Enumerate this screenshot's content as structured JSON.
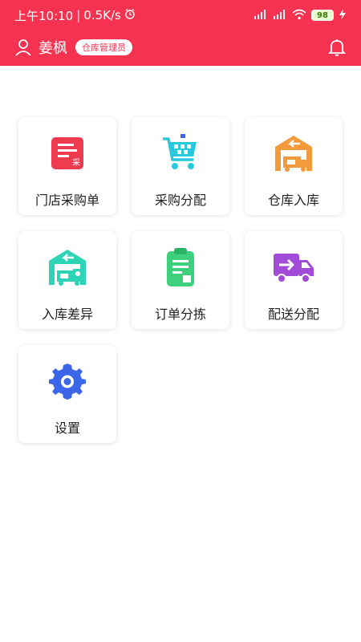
{
  "status": {
    "time": "上午10:10",
    "speed": "0.5K/s",
    "battery": "98"
  },
  "header": {
    "user_name": "姜枫",
    "role": "仓库管理员"
  },
  "menu": [
    {
      "label": "门店采购单",
      "icon": "store-purchase-order-icon",
      "badge": "采"
    },
    {
      "label": "采购分配",
      "icon": "shopping-cart-icon"
    },
    {
      "label": "仓库入库",
      "icon": "warehouse-inbound-icon"
    },
    {
      "label": "入库差异",
      "icon": "inbound-difference-icon"
    },
    {
      "label": "订单分拣",
      "icon": "clipboard-icon"
    },
    {
      "label": "配送分配",
      "icon": "delivery-truck-icon"
    },
    {
      "label": "设置",
      "icon": "gear-icon"
    }
  ],
  "colors": {
    "header": "#f5324f",
    "red_icon": "#ef3b4f",
    "cyan": "#28c9dc",
    "orange": "#f39a3c",
    "teal": "#2dd4b5",
    "green": "#3fd07e",
    "purple": "#a24bd8",
    "blue": "#3b66e8"
  }
}
